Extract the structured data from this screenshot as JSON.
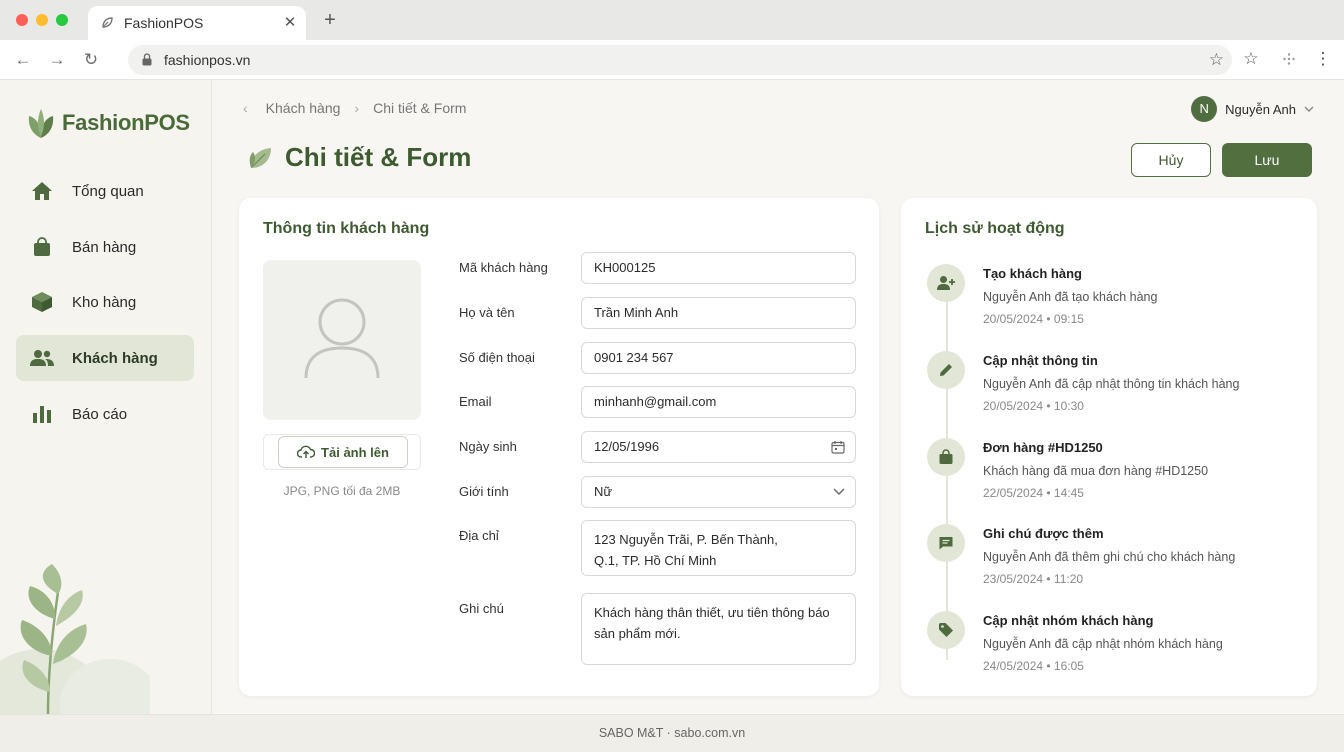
{
  "browser": {
    "tab_title": "FashionPOS",
    "url": "fashionpos.vn"
  },
  "sidebar": {
    "logo_text": "FashionPOS",
    "items": [
      {
        "label": "Tổng quan",
        "icon": "home-icon"
      },
      {
        "label": "Bán hàng",
        "icon": "shopping-bag-icon"
      },
      {
        "label": "Kho hàng",
        "icon": "box-icon"
      },
      {
        "label": "Khách hàng",
        "icon": "users-icon",
        "active": true
      },
      {
        "label": "Báo cáo",
        "icon": "bar-chart-icon"
      }
    ]
  },
  "header": {
    "breadcrumb": [
      "Khách hàng",
      "Chi tiết & Form"
    ],
    "user_initial": "N",
    "user_name": "Nguyễn Anh",
    "page_title": "Chi tiết & Form",
    "cancel_label": "Hủy",
    "save_label": "Lưu"
  },
  "customer_form": {
    "title": "Thông tin khách hàng",
    "upload_label": "Tải ảnh lên",
    "upload_hint": "JPG, PNG tối đa 2MB",
    "fields": {
      "code": {
        "label": "Mã khách hàng",
        "value": "KH000125"
      },
      "name": {
        "label": "Họ và tên",
        "value": "Trần Minh Anh"
      },
      "phone": {
        "label": "Số điện thoại",
        "value": "0901 234 567"
      },
      "email": {
        "label": "Email",
        "value": "minhanh@gmail.com"
      },
      "birthday": {
        "label": "Ngày sinh",
        "value": "12/05/1996"
      },
      "gender": {
        "label": "Giới tính",
        "value": "Nữ"
      },
      "address": {
        "label": "Địa chỉ",
        "value": "123 Nguyễn Trãi, P. Bến Thành,\nQ.1, TP. Hồ Chí Minh"
      },
      "note": {
        "label": "Ghi chú",
        "value": "Khách hàng thân thiết, ưu tiên thông báo\nsản phẩm mới."
      }
    }
  },
  "activity": {
    "title": "Lịch sử hoạt động",
    "items": [
      {
        "title": "Tạo khách hàng",
        "desc": "Nguyễn Anh đã tạo khách hàng",
        "time": "20/05/2024  •  09:15",
        "icon": "user-plus-icon"
      },
      {
        "title": "Cập nhật thông tin",
        "desc": "Nguyễn Anh đã cập nhật thông tin khách hàng",
        "time": "20/05/2024  •  10:30",
        "icon": "pencil-icon"
      },
      {
        "title": "Đơn hàng #HD1250",
        "desc": "Khách hàng đã mua đơn hàng #HD1250",
        "time": "22/05/2024  •  14:45",
        "icon": "shopping-bag-icon"
      },
      {
        "title": "Ghi chú được thêm",
        "desc": "Nguyễn Anh đã thêm ghi chú cho khách hàng",
        "time": "23/05/2024  •  11:20",
        "icon": "chat-note-icon"
      },
      {
        "title": "Cập nhật nhóm khách hàng",
        "desc": "Nguyễn Anh đã cập nhật nhóm khách hàng",
        "time": "24/05/2024  •  16:05",
        "icon": "tag-icon"
      }
    ]
  },
  "footer": {
    "text": "SABO M&T · sabo.com.vn"
  },
  "colors": {
    "primary": "#52703f",
    "title_green": "#3e5a30",
    "active_bg": "#e2e6d6"
  }
}
